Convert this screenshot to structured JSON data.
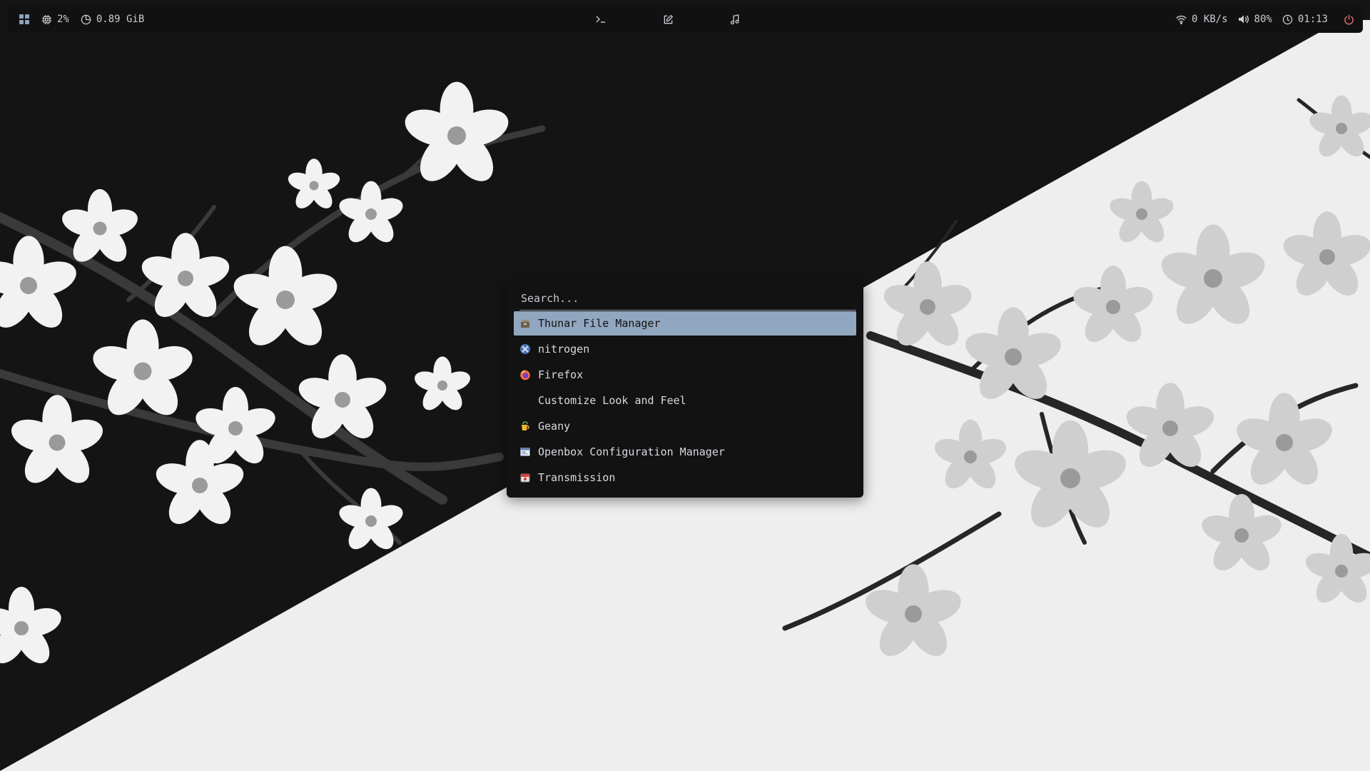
{
  "topbar": {
    "workspace_icon": "grid-icon",
    "cpu": {
      "icon": "cpu-icon",
      "value": "2%"
    },
    "memory": {
      "icon": "memory-icon",
      "value": "0.89 GiB"
    },
    "center": [
      {
        "icon": "terminal-icon"
      },
      {
        "icon": "edit-icon"
      },
      {
        "icon": "music-icon"
      }
    ],
    "network": {
      "icon": "wifi-icon",
      "value": "0 KB/s"
    },
    "volume": {
      "icon": "volume-icon",
      "value": "80%"
    },
    "clock": {
      "icon": "clock-icon",
      "value": "01:13"
    },
    "power": {
      "icon": "power-icon",
      "color": "#e06c75"
    }
  },
  "launcher": {
    "search": {
      "placeholder": "Search...",
      "value": ""
    },
    "items": [
      {
        "label": "Thunar File Manager",
        "icon": "thunar-icon",
        "selected": true
      },
      {
        "label": "nitrogen",
        "icon": "nitrogen-icon"
      },
      {
        "label": "Firefox",
        "icon": "firefox-icon"
      },
      {
        "label": "Customize Look and Feel",
        "icon": "none"
      },
      {
        "label": "Geany",
        "icon": "geany-icon"
      },
      {
        "label": "Openbox Configuration Manager",
        "icon": "obconf-icon"
      },
      {
        "label": "Transmission",
        "icon": "transmission-icon"
      }
    ],
    "accent": "#91a6bf"
  },
  "wallpaper": {
    "theme": "cherry-blossom",
    "colors": [
      "#141414",
      "#eeeeee"
    ]
  }
}
